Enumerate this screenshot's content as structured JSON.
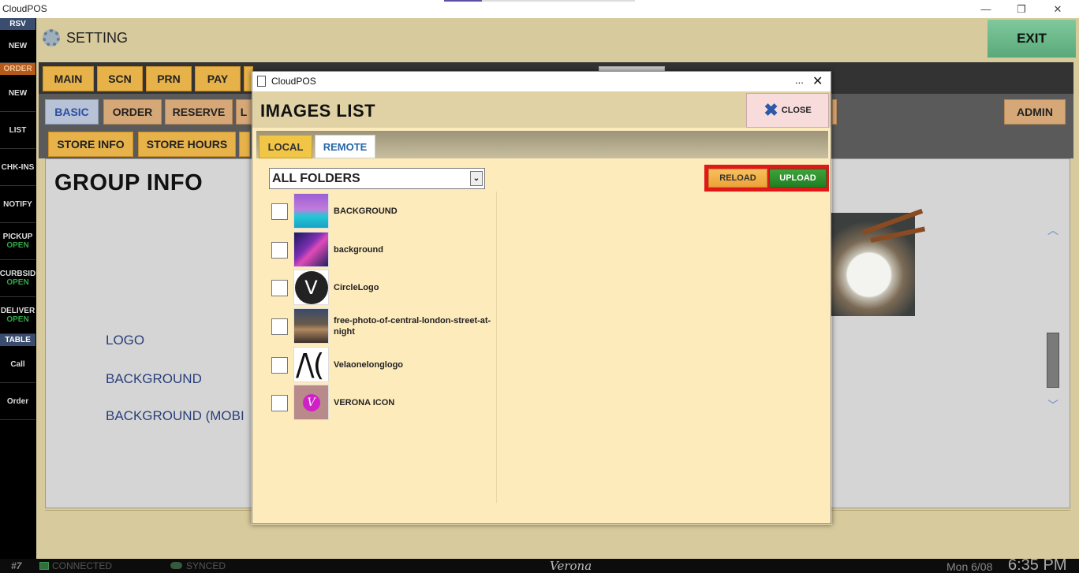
{
  "os": {
    "title": "CloudPOS",
    "min": "—",
    "restore": "❐",
    "close": "✕"
  },
  "sidebar": {
    "rsv_header": "RSV",
    "rsv_new": "NEW",
    "order_header": "ORDER",
    "order_items": [
      "NEW",
      "LIST",
      "CHK-INS",
      "NOTIFY"
    ],
    "pickup": {
      "label": "PICKUP",
      "status": "OPEN"
    },
    "curbside": {
      "label": "CURBSID",
      "status": "OPEN"
    },
    "delivery": {
      "label": "DELIVER",
      "status": "OPEN"
    },
    "table_header": "TABLE",
    "table_items": [
      "Call",
      "Order"
    ]
  },
  "header": {
    "title": "SETTING",
    "exit": "EXIT"
  },
  "tabs_main": [
    "MAIN",
    "SCN",
    "PRN",
    "PAY"
  ],
  "tabs_sub": [
    "BASIC",
    "ORDER",
    "RESERVE",
    "L"
  ],
  "admin_tab": "ADMIN",
  "tabs_store": [
    "STORE INFO",
    "STORE HOURS"
  ],
  "content": {
    "title": "GROUP INFO",
    "labels": [
      "LOGO",
      "BACKGROUND",
      "BACKGROUND (MOBI"
    ]
  },
  "status": {
    "terminal": "#7",
    "connected": "CONNECTED",
    "synced": "SYNCED",
    "brand": "Verona",
    "date": "Mon 6/08",
    "time": "6:35 PM"
  },
  "modal": {
    "window_title": "CloudPOS",
    "window_dots": "...",
    "window_close": "✕",
    "title": "IMAGES LIST",
    "close_label": "CLOSE",
    "tabs": {
      "local": "LOCAL",
      "remote": "REMOTE"
    },
    "folder": {
      "selected": "ALL FOLDERS",
      "arrow": "⌄"
    },
    "reload": "RELOAD",
    "upload": "UPLOAD",
    "images": [
      {
        "name": "BACKGROUND"
      },
      {
        "name": "background"
      },
      {
        "name": "CircleLogo"
      },
      {
        "name": "free-photo-of-central-london-street-at-night"
      },
      {
        "name": "Velaonelonglogo"
      },
      {
        "name": "VERONA ICON"
      }
    ]
  }
}
